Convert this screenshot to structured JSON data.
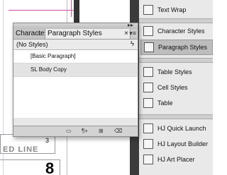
{
  "document": {
    "label": "ED LINE",
    "small_number": "3",
    "big_number": "8"
  },
  "panel": {
    "tab_inactive": "Characte",
    "tab_active": "Paragraph Styles",
    "close_symbol": "×",
    "menu_symbol": "▾≡",
    "status": "(No Styles)",
    "lightning": "ϟ",
    "styles": [
      "[Basic Paragraph]",
      "SL Body Copy"
    ],
    "selected_index": 1
  },
  "dock": {
    "items": [
      {
        "label": "Text Wrap",
        "icon": "text-wrap-icon"
      },
      {
        "label": "Character Styles",
        "icon": "character-styles-icon"
      },
      {
        "label": "Paragraph Styles",
        "icon": "paragraph-styles-icon",
        "selected": true
      },
      {
        "label": "Table Styles",
        "icon": "table-styles-icon"
      },
      {
        "label": "Cell Styles",
        "icon": "cell-styles-icon"
      },
      {
        "label": "Table",
        "icon": "table-icon"
      },
      {
        "label": "HJ Quick Launch",
        "icon": "quick-launch-icon"
      },
      {
        "label": "HJ Layout Builder",
        "icon": "layout-builder-icon"
      },
      {
        "label": "HJ Art Placer",
        "icon": "art-placer-icon"
      }
    ]
  }
}
